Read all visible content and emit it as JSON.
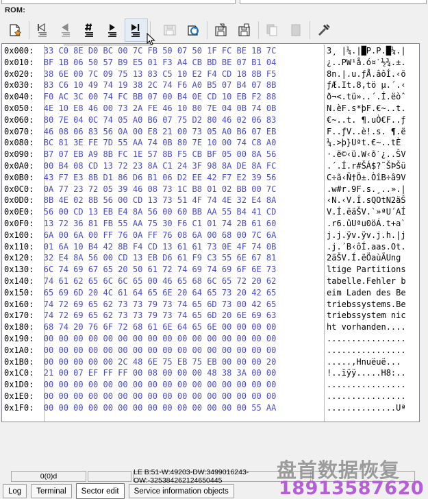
{
  "window": {
    "section_label": "ROM:"
  },
  "toolbar": {
    "buttons": [
      {
        "name": "new-sector-button",
        "icon": "new-document-icon",
        "label": "New",
        "enabled": true,
        "pressed": false
      },
      {
        "name": "first-sector-button",
        "icon": "first-sector-icon",
        "label": "First sector",
        "enabled": true,
        "pressed": false
      },
      {
        "name": "previous-sector-button",
        "icon": "previous-sector-icon",
        "label": "Previous sector",
        "enabled": true,
        "pressed": false
      },
      {
        "name": "goto-sector-button",
        "icon": "goto-sector-icon",
        "label": "Go to sector",
        "enabled": true,
        "pressed": false
      },
      {
        "name": "next-sector-button",
        "icon": "next-sector-icon",
        "label": "Next sector",
        "enabled": true,
        "pressed": false
      },
      {
        "name": "last-sector-button",
        "icon": "last-sector-icon",
        "label": "Last sector",
        "enabled": true,
        "pressed": true
      },
      {
        "name": "save-sector-button",
        "icon": "floppy-save-icon",
        "label": "Save",
        "enabled": false,
        "pressed": false
      },
      {
        "name": "refresh-sector-button",
        "icon": "refresh-sector-icon",
        "label": "Refresh",
        "enabled": true,
        "pressed": false
      },
      {
        "name": "save-to-file-button",
        "icon": "floppy-export-icon",
        "label": "Save to file",
        "enabled": true,
        "pressed": false
      },
      {
        "name": "load-from-file-button",
        "icon": "floppy-import-icon",
        "label": "Load from file",
        "enabled": true,
        "pressed": false
      },
      {
        "name": "copy-button",
        "icon": "copy-icon",
        "label": "Copy",
        "enabled": false,
        "pressed": false
      },
      {
        "name": "paste-button",
        "icon": "paste-icon",
        "label": "Paste",
        "enabled": false,
        "pressed": false
      },
      {
        "name": "tools-button",
        "icon": "hammer-wrench-icon",
        "label": "Tools",
        "enabled": true,
        "pressed": false
      }
    ]
  },
  "hex_view": {
    "offset_suffix": ":",
    "rows": [
      {
        "offset": "0x000",
        "bytes": "33 C0 8E D0 BC 00 7C FB 50 07 50 1F FC BE 1B 7C",
        "ascii": "3¸ |¼.|█P.P.█¼.|"
      },
      {
        "offset": "0x010",
        "bytes": "BF 1B 06 50 57 B9 E5 01 F3 A4 CB BD BE 07 B1 04",
        "ascii": "¿..PW¹å.ó¤ˋ½¾.±."
      },
      {
        "offset": "0x020",
        "bytes": "38 6E 00 7C 09 75 13 83 C5 10 E2 F4 CD 18 8B F5",
        "ascii": "8n.|.u.ƒÅ.âôÍ.‹õ"
      },
      {
        "offset": "0x030",
        "bytes": "83 C6 10 49 74 19 38 2C 74 F6 A0 B5 07 B4 07 8B",
        "ascii": "ƒÆ.It.8,tö µ.´.‹"
      },
      {
        "offset": "0x040",
        "bytes": "F0 AC 3C 00 74 FC BB 07 00 B4 0E CD 10 EB F2 88",
        "ascii": "ð¬<.tü»..´.Í.ëòˆ"
      },
      {
        "offset": "0x050",
        "bytes": "4E 10 E8 46 00 73 2A FE 46 10 80 7E 04 0B 74 0B",
        "ascii": "N.èF.s*þF.€~..t."
      },
      {
        "offset": "0x060",
        "bytes": "80 7E 04 0C 74 05 A0 B6 07 75 D2 80 46 02 06 83",
        "ascii": "€~..t. ¶.uÒ€F..ƒ"
      },
      {
        "offset": "0x070",
        "bytes": "46 08 06 83 56 0A 00 E8 21 00 73 05 A0 B6 07 EB",
        "ascii": "F..ƒV..è!.s. ¶.ë"
      },
      {
        "offset": "0x080",
        "bytes": "BC 81 3E FE 7D 55 AA 74 0B 80 7E 10 00 74 C8 A0",
        "ascii": "¼.>þ}Uªt.€~..tÈ "
      },
      {
        "offset": "0x090",
        "bytes": "B7 07 EB A9 8B FC 1E 57 8B F5 CB BF 05 00 8A 56",
        "ascii": "·.ë©‹ü.W‹õˋ¿..ŠV"
      },
      {
        "offset": "0x0A0",
        "bytes": "00 B4 08 CD 13 72 23 8A C1 24 3F 98 8A DE 8A FC",
        "ascii": ".´.Í.r#ŠÁ$?˜ŠÞŠü"
      },
      {
        "offset": "0x0B0",
        "bytes": "43 F7 E3 8B D1 86 D6 B1 06 D2 EE 42 F7 E2 39 56",
        "ascii": "C÷ã‹Ñ†Ö±.ÒîB÷â9V"
      },
      {
        "offset": "0x0C0",
        "bytes": "0A 77 23 72 05 39 46 08 73 1C B8 01 02 BB 00 7C",
        "ascii": ".w#r.9F.s.¸..».|"
      },
      {
        "offset": "0x0D0",
        "bytes": "8B 4E 02 8B 56 00 CD 13 73 51 4F 74 4E 32 E4 8A",
        "ascii": "‹N.‹V.Í.sQOtN2äŠ"
      },
      {
        "offset": "0x0E0",
        "bytes": "56 00 CD 13 EB E4 8A 56 00 60 BB AA 55 B4 41 CD",
        "ascii": "V.Í.ëäŠV.`»ªU´AÍ"
      },
      {
        "offset": "0x0F0",
        "bytes": "13 72 36 81 FB 55 AA 75 30 F6 C1 01 74 2B 61 60",
        "ascii": ".r6.ûUªu0öÁ.t+a`"
      },
      {
        "offset": "0x100",
        "bytes": "6A 00 6A 00 FF 76 0A FF 76 08 6A 00 68 00 7C 6A",
        "ascii": "j.j.ÿv.ÿv.j.h.|j"
      },
      {
        "offset": "0x110",
        "bytes": "01 6A 10 B4 42 8B F4 CD 13 61 61 73 0E 4F 74 0B",
        "ascii": ".j.´B‹ôÍ.aas.Ot."
      },
      {
        "offset": "0x120",
        "bytes": "32 E4 8A 56 00 CD 13 EB D6 61 F9 C3 55 6E 67 81",
        "ascii": "2äŠV.Í.ëÖaùÃUng"
      },
      {
        "offset": "0x130",
        "bytes": "6C 74 69 67 65 20 50 61 72 74 69 74 69 6F 6E 73",
        "ascii": "ltige Partitions"
      },
      {
        "offset": "0x140",
        "bytes": "74 61 62 65 6C 6C 65 00 46 65 68 6C 65 72 20 62",
        "ascii": "tabelle.Fehler b"
      },
      {
        "offset": "0x150",
        "bytes": "65 69 6D 20 4C 61 64 65 6E 20 64 65 73 20 42 65",
        "ascii": "eim Laden des Be"
      },
      {
        "offset": "0x160",
        "bytes": "74 72 69 65 62 73 73 79 73 74 65 6D 73 00 42 65",
        "ascii": "triebssystems.Be"
      },
      {
        "offset": "0x170",
        "bytes": "74 72 69 65 62 73 73 79 73 74 65 6D 20 6E 69 63",
        "ascii": "triebssystem nic"
      },
      {
        "offset": "0x180",
        "bytes": "68 74 20 76 6F 72 68 61 6E 64 65 6E 00 00 00 00",
        "ascii": "ht vorhanden...."
      },
      {
        "offset": "0x190",
        "bytes": "00 00 00 00 00 00 00 00 00 00 00 00 00 00 00 00",
        "ascii": "................"
      },
      {
        "offset": "0x1A0",
        "bytes": "00 00 00 00 00 00 00 00 00 00 00 00 00 00 00 00",
        "ascii": "................"
      },
      {
        "offset": "0x1B0",
        "bytes": "00 00 00 00 00 2C 48 6E 75 EB 75 EB 00 00 00 20",
        "ascii": ".....,Hnuëuë... "
      },
      {
        "offset": "0x1C0",
        "bytes": "21 00 07 EF FF FF 00 08 00 00 00 48 38 3A 00 00",
        "ascii": "!..ïÿÿ.....H8:.."
      },
      {
        "offset": "0x1D0",
        "bytes": "00 00 00 00 00 00 00 00 00 00 00 00 00 00 00 00",
        "ascii": "................"
      },
      {
        "offset": "0x1E0",
        "bytes": "00 00 00 00 00 00 00 00 00 00 00 00 00 00 00 00",
        "ascii": "................"
      },
      {
        "offset": "0x1F0",
        "bytes": "00 00 00 00 00 00 00 00 00 00 00 00 00 00 55 AA",
        "ascii": "..............Uª"
      }
    ]
  },
  "status_bar": {
    "position": "0(0)d",
    "spacer": "",
    "values": "LE B:51-W:49203-DW:3499016243-QW:-325384262124650445",
    "extra": ""
  },
  "tabs": {
    "items": [
      {
        "label": "Log",
        "active": false
      },
      {
        "label": "Terminal",
        "active": false
      },
      {
        "label": "Sector edit",
        "active": true
      },
      {
        "label": "Service information objects",
        "active": false
      }
    ]
  },
  "watermark": {
    "company": "盘首数据恢复",
    "phone": "18913587620",
    "phone_color": "#b45fd6"
  },
  "colors": {
    "hex_byte_color": "#4a4ad0",
    "panel_background": "#ffffff",
    "chrome_background": "#f0f0f0"
  }
}
